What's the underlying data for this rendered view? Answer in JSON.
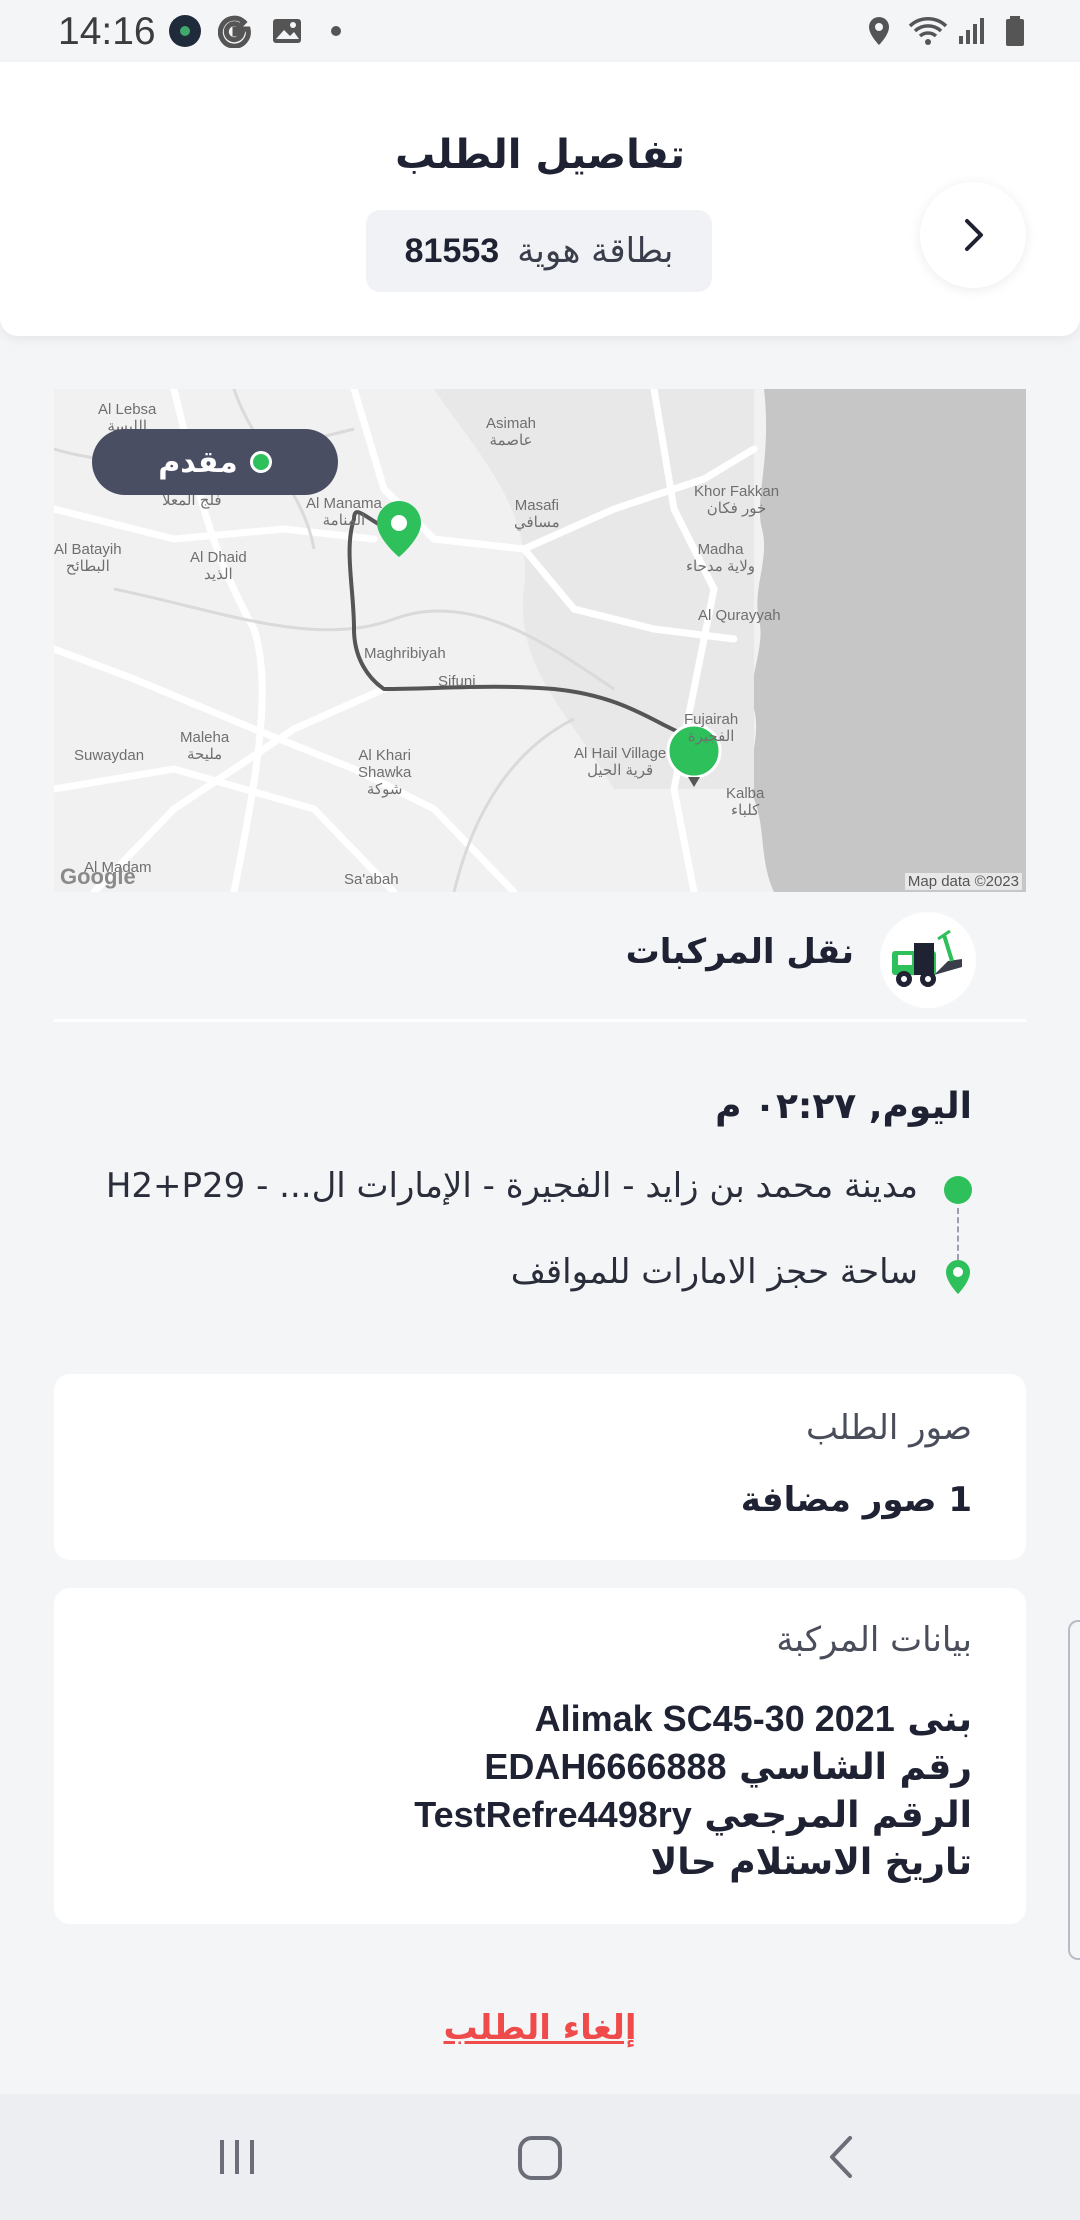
{
  "status_bar": {
    "time": "14:16"
  },
  "header": {
    "title": "تفاصيل الطلب",
    "id_label": "بطاقة هوية",
    "id_number": "81553"
  },
  "map": {
    "status_chip": "مقدم",
    "labels": [
      "Al Lebsa\nاللبسة",
      "Asimah\nعاصمة",
      "Mualla\nفلج المعلا",
      "Al Manama\nالمنامة",
      "Masafi\nمسافي",
      "Khor Fakkan\nخور فكان",
      "Al Batayih\nالبطائح",
      "Al Dhaid\nالذيد",
      "Madha\nولاية مدحاء",
      "Al Qurayyah",
      "Maghribiyah",
      "Sifuni",
      "Fujairah\nالفجيرة",
      "Maleha\nمليحة",
      "Suwaydan",
      "Al Khari\nShawka\nشوكة",
      "Al Hail Village\nقرية الحيل",
      "Kalba\nكلباء",
      "Al Madam",
      "Sa'abah"
    ],
    "google": "Google",
    "attribution": "Map data ©2023"
  },
  "service": {
    "name": "نقل المركبات"
  },
  "trip": {
    "date": "اليوم, ٠٢:٢٧ م",
    "from": "مدينة محمد بن زايد - الفجيرة - الإمارات ال... - H2+P29",
    "to": "ساحة حجز الامارات للمواقف"
  },
  "photos": {
    "title": "صور الطلب",
    "value": "1 صور مضافة"
  },
  "vehicle": {
    "title": "بيانات المركبة",
    "make_label": "بنى",
    "make_value": "Alimak SC45-30 2021",
    "chassis_label": "رقم الشاسي",
    "chassis_value": "EDAH6666888",
    "ref_label": "الرقم المرجعي",
    "ref_value": "TestRefre4498ry",
    "receive_label": "تاريخ الاستلام",
    "receive_value": "حالا"
  },
  "actions": {
    "cancel": "إلغاء الطلب"
  },
  "colors": {
    "accent_green": "#2ec05a",
    "chip_bg": "#4a4e63",
    "cancel_red": "#f04b4b",
    "sea": "#c6c6c6"
  }
}
